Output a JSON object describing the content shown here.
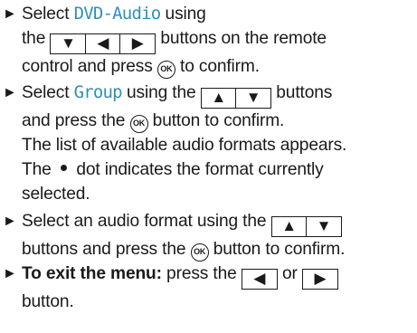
{
  "bullet_glyph": "►",
  "icons": {
    "key_up": "▲",
    "key_down": "▼",
    "key_left": "◀",
    "key_right": "▶",
    "ok": "OK"
  },
  "accent_color": "#2f8fbd",
  "items": [
    {
      "l1_a": "Select ",
      "term": "DVD-Audio",
      "l1_b": " using",
      "l2_a": "the ",
      "l2_b": " buttons on the remote",
      "l3_a": "control and press ",
      "l3_b": " to confirm."
    },
    {
      "l1_a": "Select ",
      "term": "Group",
      "l1_b": " using the ",
      "l1_c": " buttons",
      "l2_a": "and press the ",
      "l2_b": " button to confirm.",
      "l3": "The list of available audio formats appears.",
      "l4_a": "The ",
      "l4_b": " dot indicates the format currently",
      "l5": "selected."
    },
    {
      "l1_a": "Select an audio format using the ",
      "l2_a": "buttons and press the ",
      "l2_b": " button to confirm."
    },
    {
      "bold": "To exit the menu:",
      "l1_a": " press the ",
      "l1_b": " or ",
      "l2": "button."
    }
  ]
}
